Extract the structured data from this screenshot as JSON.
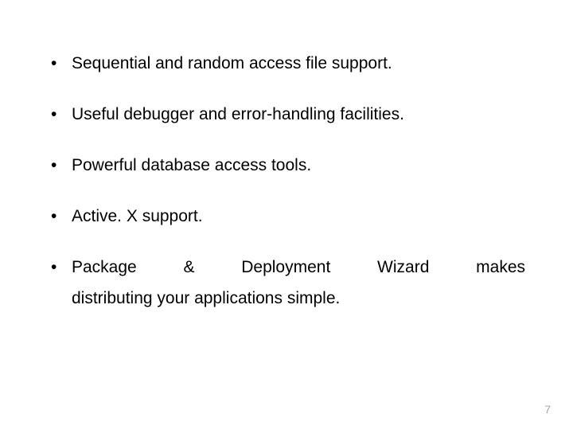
{
  "bullets": [
    "Sequential and random access file support.",
    "Useful debugger and error-handling facilities.",
    "Powerful database access tools.",
    "Active. X support."
  ],
  "bullet5": {
    "line1": "Package & Deployment Wizard makes",
    "line2": "distributing your applications simple."
  },
  "pageNumber": "7"
}
